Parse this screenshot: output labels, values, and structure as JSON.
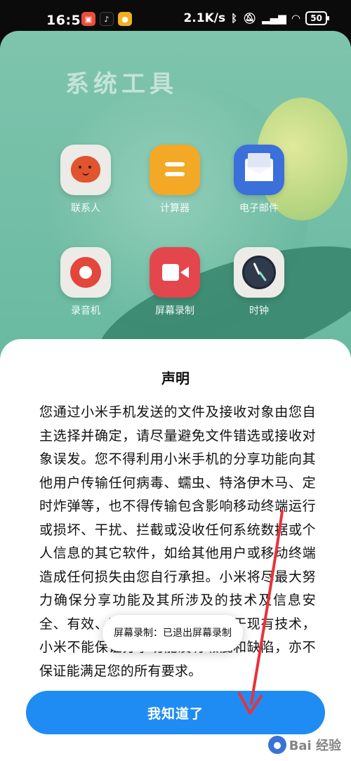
{
  "status_bar": {
    "time": "16:58",
    "network_speed": "2.1K/s",
    "battery": "50",
    "icons": [
      "weibo-app-icon",
      "tiktok-app-icon",
      "notes-app-icon",
      "bluetooth-icon",
      "mute-icon",
      "signal-icon",
      "wifi-icon",
      "battery-icon"
    ]
  },
  "home": {
    "folder_title": "系统工具",
    "apps": [
      {
        "label": "联系人",
        "icon": "contacts-icon"
      },
      {
        "label": "计算器",
        "icon": "calculator-icon"
      },
      {
        "label": "电子邮件",
        "icon": "email-icon"
      },
      {
        "label": "录音机",
        "icon": "recorder-icon"
      },
      {
        "label": "屏幕录制",
        "icon": "screen-record-icon"
      },
      {
        "label": "时钟",
        "icon": "clock-icon"
      }
    ]
  },
  "dialog": {
    "title": "声明",
    "body": "您通过小米手机发送的文件及接收对象由您自主选择并确定，请尽量避免文件错选或接收对象误发。您不得利用小米手机的分享功能向其他用户传输任何病毒、蠕虫、特洛伊木马、定时炸弹等，也不得传输包含影响移动终端运行或损坏、干扰、拦截或没收任何系统数据或个人信息的其它软件，如给其他用户或移动终端造成任何损失由您自行承担。小米将尽最大努力确保分享功能及其所涉及的技术及信息安全、有效、准确、可靠，但受限于现有技术，小米不能保证分享功能没有瑕疵和缺陷，亦不保证能满足您的所有要求。",
    "confirm_label": "我知道了"
  },
  "toast": {
    "text": "屏幕录制：已退出屏幕录制"
  },
  "watermark": {
    "text": "Bai 经验"
  },
  "colors": {
    "accent": "#1f8cf3",
    "annotation": "#e8323a"
  }
}
